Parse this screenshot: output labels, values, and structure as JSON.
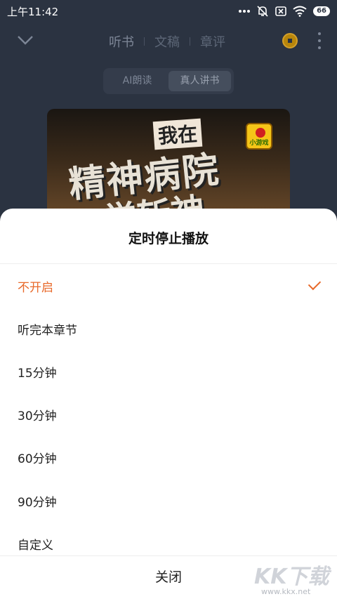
{
  "status_bar": {
    "time": "上午11:42",
    "battery": "66",
    "icons": [
      "dots-icon",
      "mute-icon",
      "sim-icon",
      "wifi-icon",
      "battery-icon"
    ]
  },
  "nav": {
    "tabs": [
      {
        "label": "听书",
        "active": true
      },
      {
        "label": "文稿",
        "active": false
      },
      {
        "label": "章评",
        "active": false
      }
    ],
    "icons": [
      "chevron-down-icon",
      "coin-icon",
      "more-icon"
    ]
  },
  "mode_switch": {
    "options": [
      "AI朗读",
      "真人讲书"
    ],
    "selected": "真人讲书"
  },
  "cover": {
    "line1": "我在",
    "line2": "精神病院",
    "line3": "学斩神",
    "badge": "小游戏"
  },
  "sheet": {
    "title": "定时停止播放",
    "options": [
      "不开启",
      "听完本章节",
      "15分钟",
      "30分钟",
      "60分钟",
      "90分钟",
      "自定义"
    ],
    "selected_index": 0,
    "close_label": "关闭"
  },
  "watermark": {
    "main": "KK下载",
    "sub": "www.kkx.net"
  },
  "colors": {
    "accent": "#e8692a",
    "background": "#2b3341",
    "sheet": "#ffffff"
  }
}
